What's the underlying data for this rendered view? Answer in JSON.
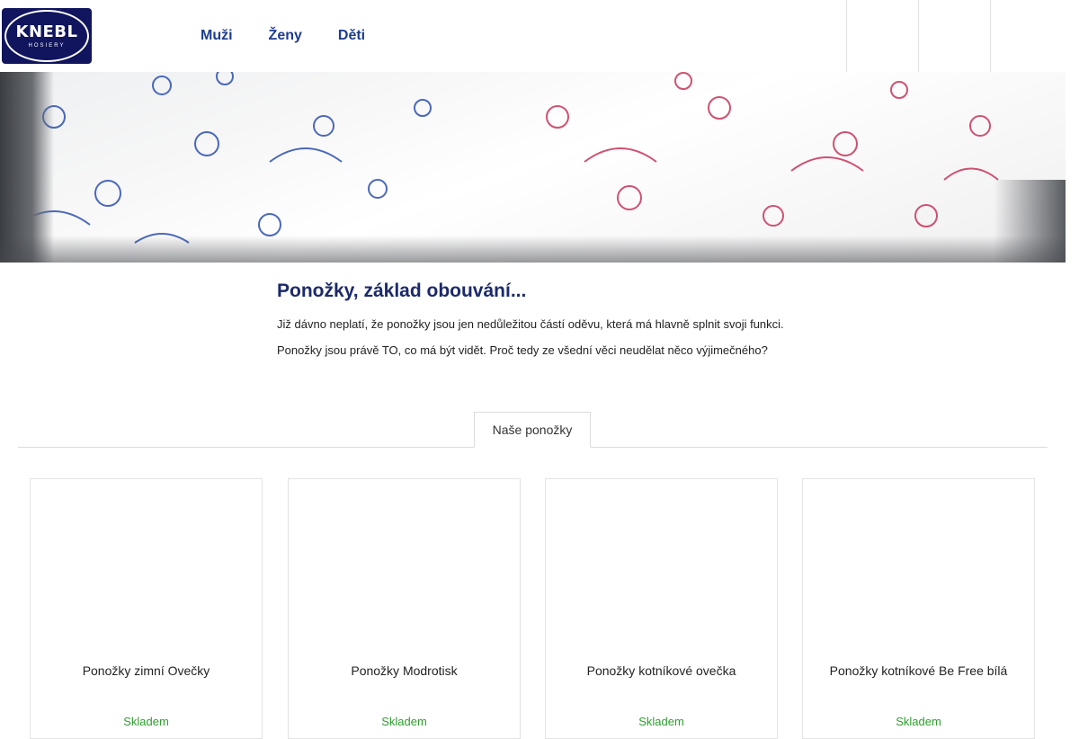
{
  "brand": {
    "logo_text": "KNEBL",
    "logo_subtext": "HOSIERY"
  },
  "nav": {
    "items": [
      "Muži",
      "Ženy",
      "Děti"
    ]
  },
  "header_buttons": [
    {
      "icon": "search-icon",
      "glyph": ""
    },
    {
      "icon": "user-icon",
      "glyph": ""
    },
    {
      "icon": "cart-icon",
      "glyph": ""
    }
  ],
  "intro": {
    "title": "Ponožky, základ obouvání...",
    "paragraphs": [
      "Již dávno neplatí, že ponožky jsou jen nedůležitou částí oděvu, která má hlavně splnit svoji funkci.",
      "Ponožky jsou právě TO, co má být vidět. Proč tedy ze všední věci neudělat něco výjimečného?"
    ]
  },
  "tab": {
    "label": "Naše ponožky"
  },
  "products": [
    {
      "name": "Ponožky zimní Ovečky",
      "stock": "Skladem"
    },
    {
      "name": "Ponožky Modrotisk",
      "stock": "Skladem"
    },
    {
      "name": "Ponožky kotníkové ovečka",
      "stock": "Skladem"
    },
    {
      "name": "Ponožky kotníkové Be Free bílá",
      "stock": "Skladem"
    }
  ],
  "colors": {
    "nav": "#1d3c8f",
    "title": "#1c2a6b",
    "stock": "#2e9e2e",
    "logo_bg": "#10155e"
  }
}
